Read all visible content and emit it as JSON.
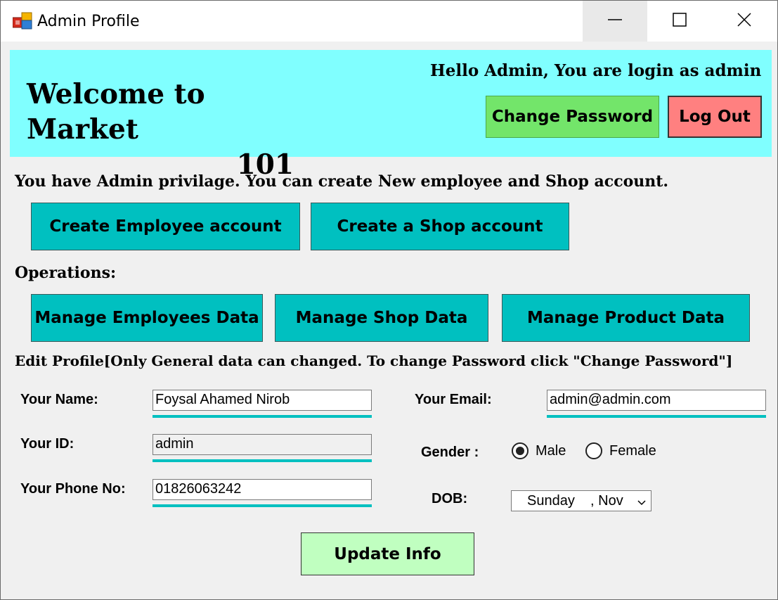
{
  "window": {
    "title": "Admin Profile"
  },
  "header": {
    "welcome_line1": "Welcome to Market",
    "welcome_line2": "101",
    "greeting": "Hello Admin, You are login as admin",
    "change_password_label": "Change Password",
    "logout_label": "Log Out",
    "background_color": "#80ffff"
  },
  "admin_section": {
    "privilege_text": "You have Admin privilage. You can create New employee and Shop account.",
    "create_employee_label": "Create Employee account",
    "create_shop_label": "Create a Shop account"
  },
  "operations": {
    "heading": "Operations:",
    "manage_employees_label": "Manage Employees Data",
    "manage_shop_label": "Manage Shop Data",
    "manage_product_label": "Manage Product Data"
  },
  "edit_profile": {
    "heading": "Edit Profile[Only General data can changed. To change Password click \"Change Password\"]",
    "name_label": "Your Name:",
    "name_value": "Foysal Ahamed Nirob",
    "id_label": "Your ID:",
    "id_value": "admin",
    "phone_label": "Your Phone No:",
    "phone_value": "01826063242",
    "email_label": "Your Email:",
    "email_value": "admin@admin.com",
    "gender_label": "Gender :",
    "gender_options": [
      "Male",
      "Female"
    ],
    "gender_selected": "Male",
    "dob_label": "DOB:",
    "dob_value": "Sunday    , Nov",
    "update_label": "Update Info"
  },
  "colors": {
    "accent_teal": "#00c0c0",
    "change_password_bg": "#73e56a",
    "logout_bg": "#ff8080",
    "update_bg": "#c0ffc0"
  },
  "icons": {
    "app": "app-icon",
    "minimize": "minimize-icon",
    "maximize": "maximize-icon",
    "close": "close-icon",
    "dropdown": "chevron-down-icon"
  }
}
